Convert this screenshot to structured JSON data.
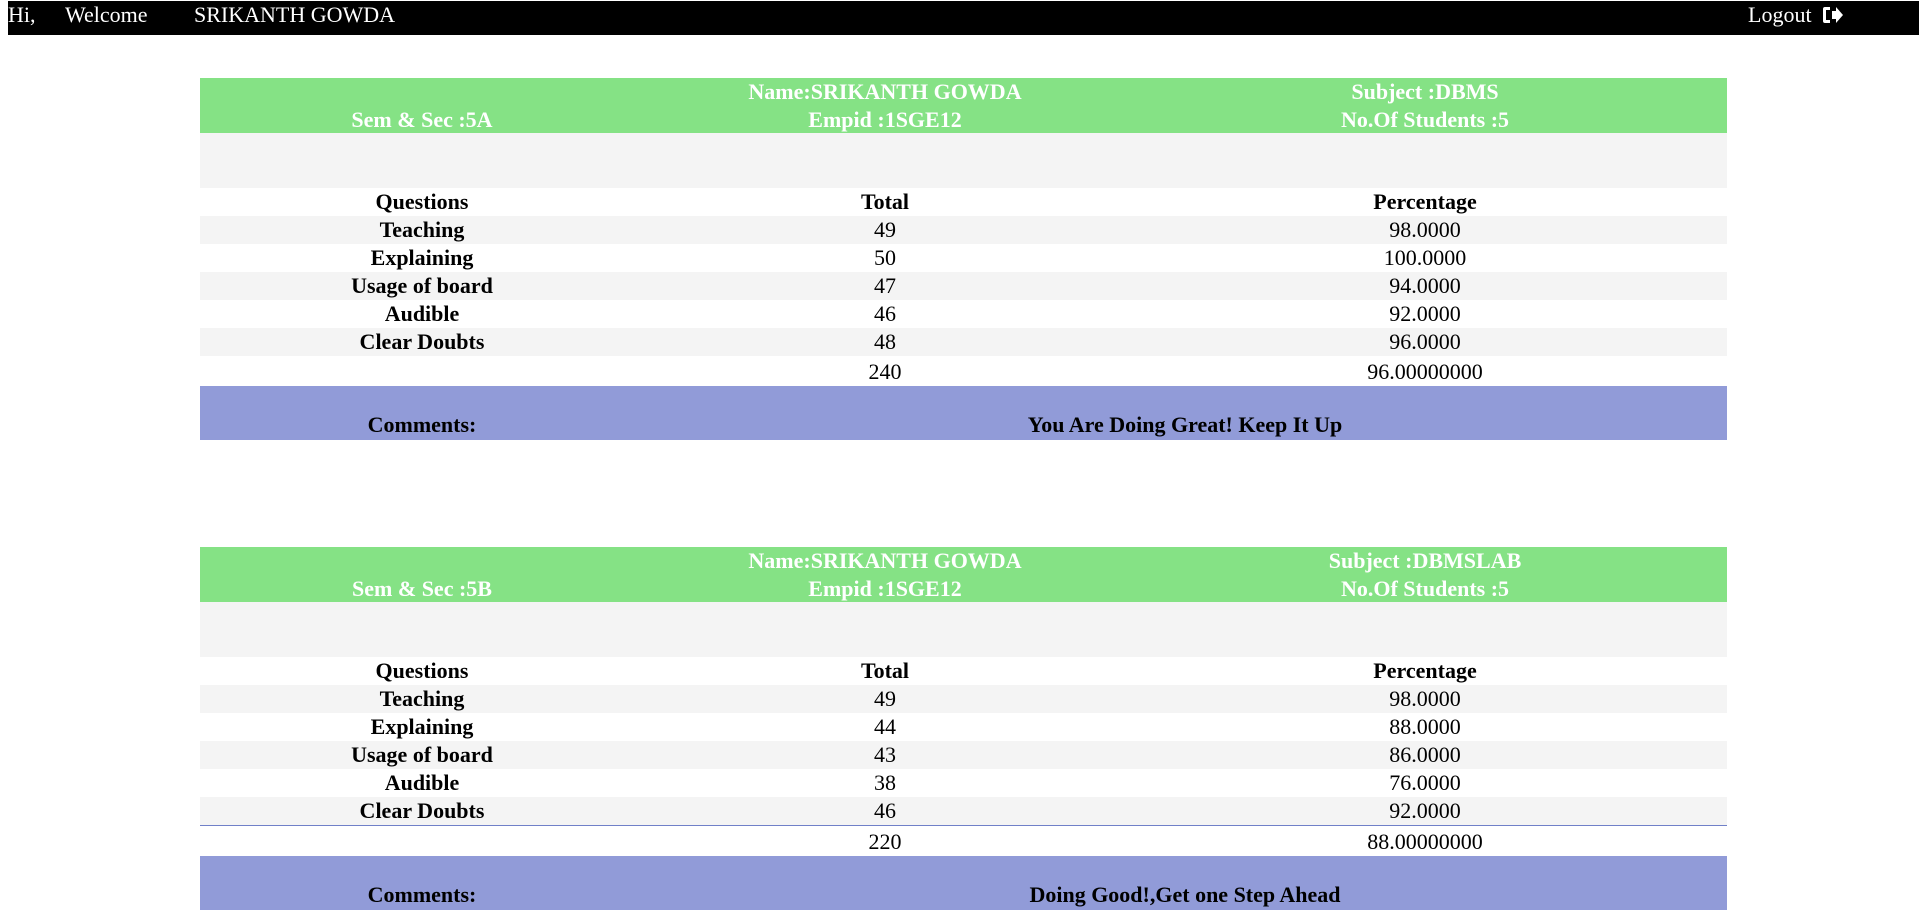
{
  "header": {
    "greeting": "Hi,",
    "welcome": "Welcome",
    "user_name": "SRIKANTH GOWDA",
    "logout_label": "Logout",
    "logout_icon": "sign-out-icon"
  },
  "table_columns": [
    "Questions",
    "Total",
    "Percentage"
  ],
  "comments_label": "Comments:",
  "cards": [
    {
      "name": "Name:SRIKANTH GOWDA",
      "subject": "Subject :DBMS",
      "sem_sec": "Sem & Sec :5A",
      "empid": "Empid :1SGE12",
      "students": "No.Of Students :5",
      "rows": [
        {
          "question": "Teaching",
          "total": "49",
          "percentage": "98.0000"
        },
        {
          "question": "Explaining",
          "total": "50",
          "percentage": "100.0000"
        },
        {
          "question": "Usage of board",
          "total": "47",
          "percentage": "94.0000"
        },
        {
          "question": "Audible",
          "total": "46",
          "percentage": "92.0000"
        },
        {
          "question": "Clear Doubts",
          "total": "48",
          "percentage": "96.0000"
        }
      ],
      "grand_total": "240",
      "grand_percentage": "96.00000000",
      "comment": "You Are Doing Great! Keep It Up"
    },
    {
      "name": "Name:SRIKANTH GOWDA",
      "subject": "Subject :DBMSLAB",
      "sem_sec": "Sem & Sec :5B",
      "empid": "Empid :1SGE12",
      "students": "No.Of Students :5",
      "rows": [
        {
          "question": "Teaching",
          "total": "49",
          "percentage": "98.0000"
        },
        {
          "question": "Explaining",
          "total": "44",
          "percentage": "88.0000"
        },
        {
          "question": "Usage of board",
          "total": "43",
          "percentage": "86.0000"
        },
        {
          "question": "Audible",
          "total": "38",
          "percentage": "76.0000"
        },
        {
          "question": "Clear Doubts",
          "total": "46",
          "percentage": "92.0000"
        }
      ],
      "grand_total": "220",
      "grand_percentage": "88.00000000",
      "comment": "Doing Good!,Get one Step Ahead"
    }
  ],
  "colors": {
    "topbar": "#000000",
    "card_header": "#85e285",
    "comments_bar": "#919bd8",
    "alt_row": "#f4f4f4"
  }
}
